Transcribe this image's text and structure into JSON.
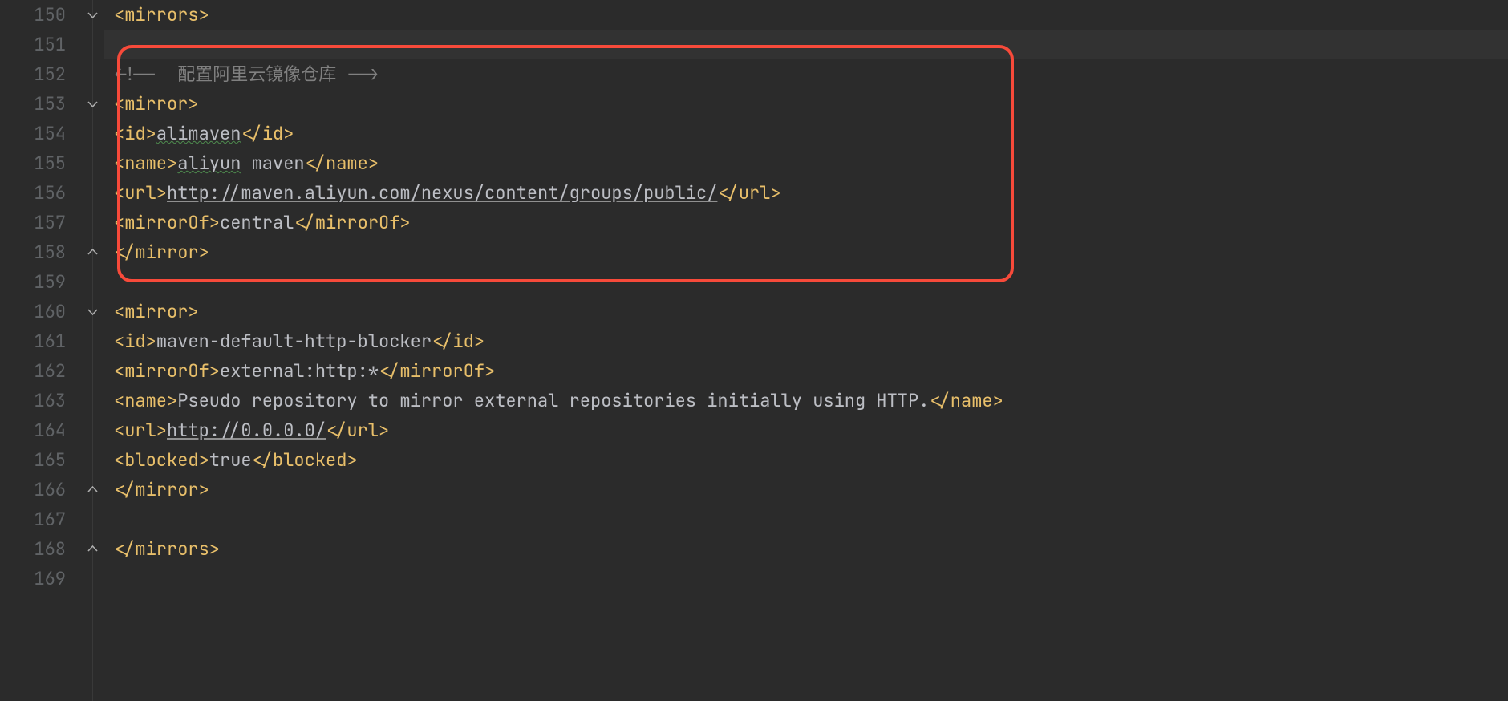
{
  "lineNumbers": [
    "150",
    "151",
    "152",
    "153",
    "154",
    "155",
    "156",
    "157",
    "158",
    "159",
    "160",
    "161",
    "162",
    "163",
    "164",
    "165",
    "166",
    "167",
    "168",
    "169"
  ],
  "code": {
    "l150": {
      "tag_open": "<mirrors>"
    },
    "l152": {
      "comment_open": "<!-- ",
      "comment_text": " 配置阿里云镜像仓库 ",
      "comment_close": "-->"
    },
    "l153": {
      "tag_open": "<mirror>"
    },
    "l154": {
      "open": "<id>",
      "value": "alimaven",
      "close": "</id>"
    },
    "l155": {
      "open": "<name>",
      "value1": "aliyun",
      "space": " ",
      "value2": "maven",
      "close": "</name>"
    },
    "l156": {
      "open": "<url>",
      "value": "http://maven.aliyun.com/nexus/content/groups/public/",
      "close": "</url>"
    },
    "l157": {
      "open": "<mirrorOf>",
      "value": "central",
      "close": "</mirrorOf>"
    },
    "l158": {
      "tag_close": "</mirror>"
    },
    "l160": {
      "tag_open": "<mirror>"
    },
    "l161": {
      "open": "<id>",
      "value": "maven-default-http-blocker",
      "close": "</id>"
    },
    "l162": {
      "open": "<mirrorOf>",
      "value": "external:http:*",
      "close": "</mirrorOf>"
    },
    "l163": {
      "open": "<name>",
      "value": "Pseudo repository to mirror external repositories initially using HTTP.",
      "close": "</name>"
    },
    "l164": {
      "open": "<url>",
      "value": "http://0.0.0.0/",
      "close": "</url>"
    },
    "l165": {
      "open": "<blocked>",
      "value": "true",
      "close": "</blocked>"
    },
    "l166": {
      "tag_close": "</mirror>"
    },
    "l168": {
      "tag_close": "</mirrors>"
    }
  },
  "annotation": {
    "box": {
      "topLineIndex": 1,
      "bottomLineIndex": 9
    }
  }
}
